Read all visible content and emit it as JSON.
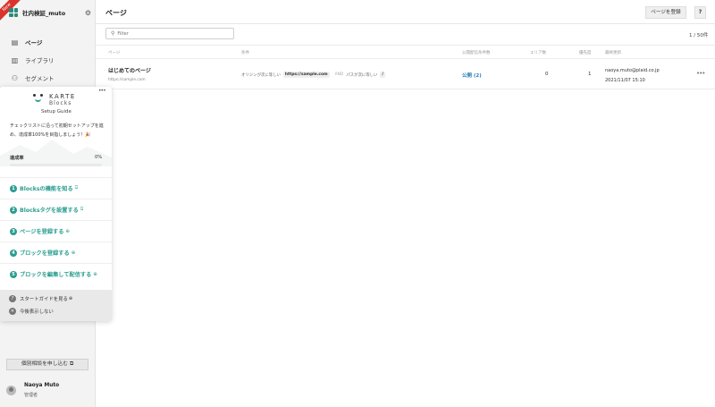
{
  "sidebar": {
    "ribbon": "New",
    "project_name": "社内検証_muto",
    "nav": [
      {
        "label": "ページ",
        "icon": "page-icon"
      },
      {
        "label": "ライブラリ",
        "icon": "library-icon"
      },
      {
        "label": "セグメント",
        "icon": "segment-icon"
      }
    ],
    "consult_label": "個別相談を申し込む",
    "consult_icon": "external-link-icon",
    "user_name": "Naoya Muto",
    "user_role": "管理者"
  },
  "header": {
    "title": "ページ",
    "register_label": "ページを登録",
    "help_label": "?"
  },
  "filter": {
    "placeholder": "Filter",
    "search_icon": "search-icon"
  },
  "pager": "1 / 50件",
  "table": {
    "columns": [
      "ページ",
      "条件",
      "公開配信条件数",
      "エリア数",
      "優先度",
      "最終更新"
    ],
    "rows": [
      {
        "name": "はじめてのページ",
        "url": "https://sample.com",
        "cond_origin_label": "オリジンが次に等しい",
        "cond_origin_value": "https://sample.com",
        "cond_and": "AND",
        "cond_path_label": "パスが次に等しい",
        "cond_path_value": "/",
        "publish": "公開 (2)",
        "areas": "0",
        "priority": "1",
        "updated_by": "naoya.muto@plaid.co.jp",
        "updated_at": "2021/11/07 15:10",
        "more": "•••"
      }
    ]
  },
  "guide": {
    "brand_top": "KARTE",
    "brand_bottom": "Blocks",
    "subtitle": "Setup Guide",
    "description": "チェックリストに沿って初期セットアップを進め、達成率100%を目指しましょう！",
    "rate_label": "達成率",
    "rate_value": "0%",
    "rate_fraction": 0,
    "steps": [
      {
        "num": "1",
        "label": "Blocksの機能を知る",
        "tail": "⍈"
      },
      {
        "num": "2",
        "label": "Blocksタグを設置する",
        "tail": "⍈"
      },
      {
        "num": "3",
        "label": "ページを登録する",
        "tail": "⊕"
      },
      {
        "num": "4",
        "label": "ブロックを登録する",
        "tail": "⊕"
      },
      {
        "num": "5",
        "label": "ブロックを編集して配信する",
        "tail": "⊕"
      }
    ],
    "footer_start": "スタートガイドを見る",
    "footer_hide": "今後表示しない",
    "accent": "#2a9d8f"
  }
}
